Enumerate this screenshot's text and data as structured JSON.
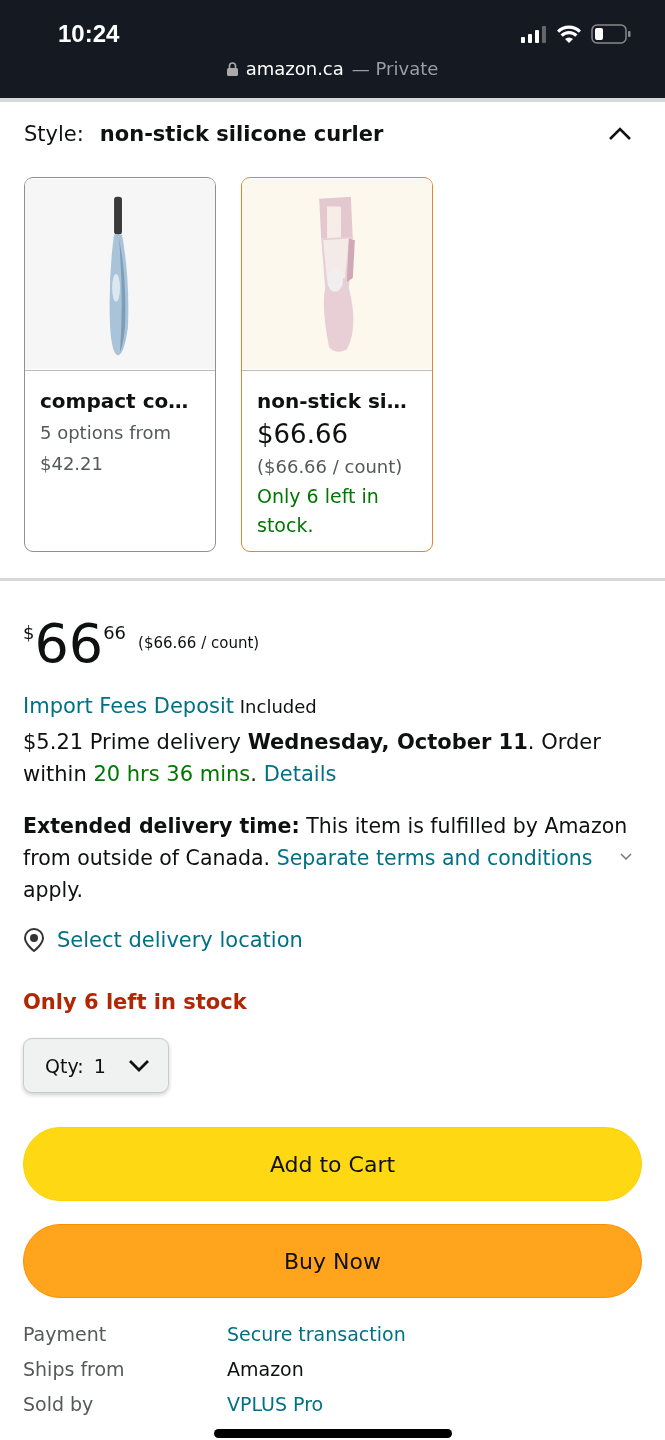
{
  "status_bar": {
    "time": "10:24",
    "url": "amazon.ca",
    "mode": "— Private"
  },
  "style_selector": {
    "label": "Style:",
    "value": "non-stick silicone curler",
    "expanded": true
  },
  "style_options": [
    {
      "title": "compact co…",
      "selected": false,
      "image": {
        "kind": "picture"
      },
      "details": [
        {
          "kind": "muted",
          "text": "5 options from $42.21"
        }
      ]
    },
    {
      "title": "non-stick si…",
      "selected": true,
      "image": {
        "kind": "picture"
      },
      "details": [
        {
          "kind": "price",
          "text": "$66.66"
        },
        {
          "kind": "muted",
          "text": "($66.66 / count)"
        },
        {
          "kind": "stock",
          "text": "Only 6 left in stock."
        }
      ]
    }
  ],
  "price": {
    "symbol": "$",
    "whole": "66",
    "fraction": "66",
    "per_unit": "($66.66 / count)"
  },
  "import_fees": {
    "link": "Import Fees Deposit",
    "note": "Included"
  },
  "delivery": [
    {
      "kind": "text",
      "text": "$5.21 Prime delivery "
    },
    {
      "kind": "bold",
      "text": "Wednesday, October 11"
    },
    {
      "kind": "text",
      "text": ". Order within "
    },
    {
      "kind": "countdown",
      "text": "20 hrs 36 mins"
    },
    {
      "kind": "text",
      "text": ". "
    },
    {
      "kind": "link",
      "text": "Details"
    }
  ],
  "extended_delivery": [
    {
      "kind": "bold",
      "text": "Extended delivery time:"
    },
    {
      "kind": "text",
      "text": " This item is fulfilled by Amazon from outside of Canada. "
    },
    {
      "kind": "link",
      "text": "Separate terms and conditions"
    },
    {
      "kind": "expand"
    },
    {
      "kind": "text",
      "text": "apply."
    }
  ],
  "location_link": "Select delivery location",
  "stock_warning": "Only 6 left in stock",
  "quantity": {
    "label": "Qty:",
    "value": "1"
  },
  "buttons": [
    {
      "kind": "cart",
      "label": "Add to Cart"
    },
    {
      "kind": "buy",
      "label": "Buy Now"
    }
  ],
  "info_rows": [
    {
      "label": "Payment",
      "value": "Secure transaction",
      "kind": "link"
    },
    {
      "label": "Ships from",
      "value": "Amazon",
      "kind": "text"
    },
    {
      "label": "Sold by",
      "value": "VPLUS Pro",
      "kind": "link"
    }
  ]
}
